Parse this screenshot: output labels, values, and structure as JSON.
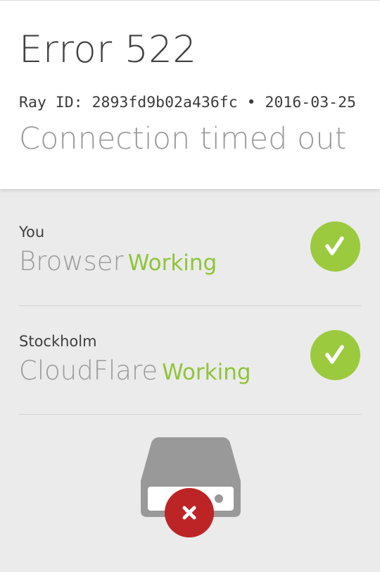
{
  "header": {
    "title": "Error 522",
    "ray_label": "Ray ID:",
    "ray_id": "2893fd9b02a436fc",
    "separator": "•",
    "date": "2016-03-25",
    "subtitle": "Connection timed out"
  },
  "status": [
    {
      "location": "You",
      "node": "Browser",
      "state": "Working",
      "icon": "check-icon",
      "color": "#9bca3e"
    },
    {
      "location": "Stockholm",
      "node": "CloudFlare",
      "state": "Working",
      "icon": "check-icon",
      "color": "#9bca3e"
    },
    {
      "node_icon": "server-icon",
      "state_icon": "error-x-icon",
      "color": "#bd2426"
    }
  ],
  "colors": {
    "working": "#8fc43a",
    "error": "#bd2426",
    "server_gray": "#999999"
  }
}
